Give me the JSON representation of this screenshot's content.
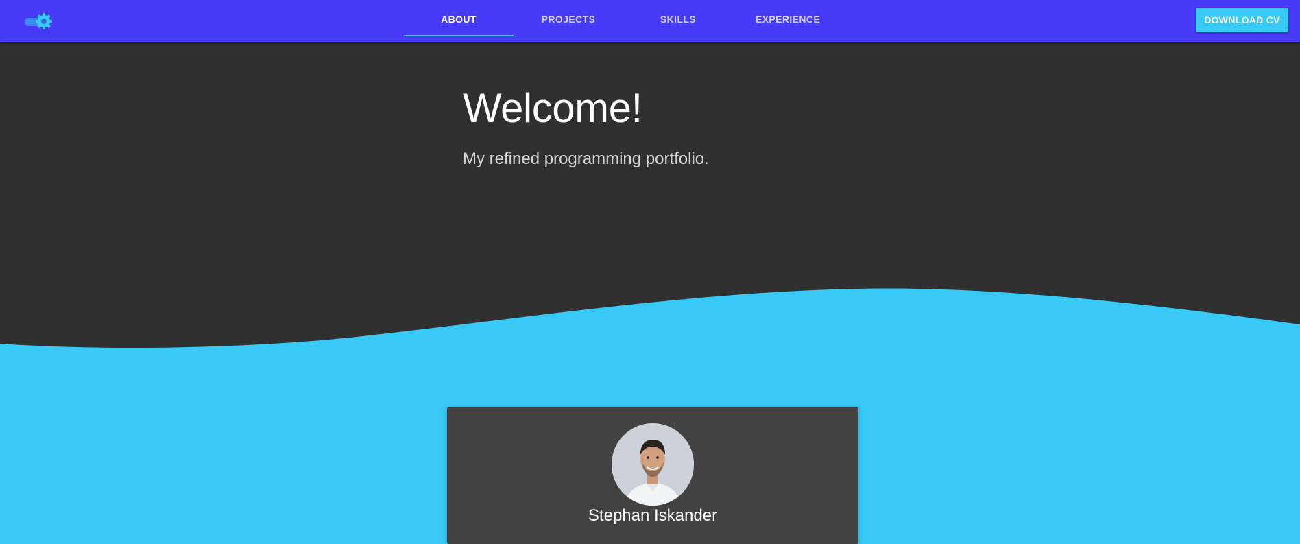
{
  "header": {
    "tabs": [
      {
        "label": "ABOUT",
        "active": true
      },
      {
        "label": "PROJECTS",
        "active": false
      },
      {
        "label": "SKILLS",
        "active": false
      },
      {
        "label": "EXPERIENCE",
        "active": false
      }
    ],
    "download_label": "DOWNLOAD CV",
    "theme_toggle_icon": "gear-toggle-icon"
  },
  "hero": {
    "title": "Welcome!",
    "subtitle": "My refined programming portfolio."
  },
  "profile": {
    "name": "Stephan Iskander",
    "avatar_icon": "avatar-photo"
  },
  "colors": {
    "header_bg": "#473bf8",
    "accent": "#38c9f7",
    "hero_bg": "#303030",
    "card_bg": "#424242"
  }
}
